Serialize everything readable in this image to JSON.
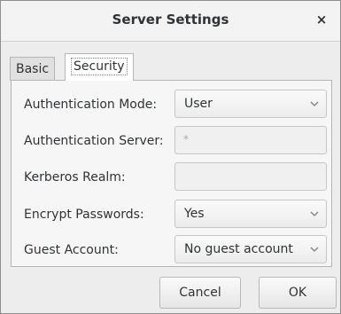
{
  "window": {
    "title": "Server Settings",
    "close_glyph": "×"
  },
  "tabs": [
    {
      "label": "Basic"
    },
    {
      "label": "Security"
    }
  ],
  "form": {
    "auth_mode": {
      "label": "Authentication Mode:",
      "value": "User"
    },
    "auth_server": {
      "label": "Authentication Server:",
      "placeholder": "*"
    },
    "kerberos": {
      "label": "Kerberos Realm:",
      "value": ""
    },
    "encrypt": {
      "label": "Encrypt Passwords:",
      "value": "Yes"
    },
    "guest": {
      "label": "Guest Account:",
      "value": "No guest account"
    }
  },
  "buttons": {
    "cancel": "Cancel",
    "ok": "OK"
  }
}
